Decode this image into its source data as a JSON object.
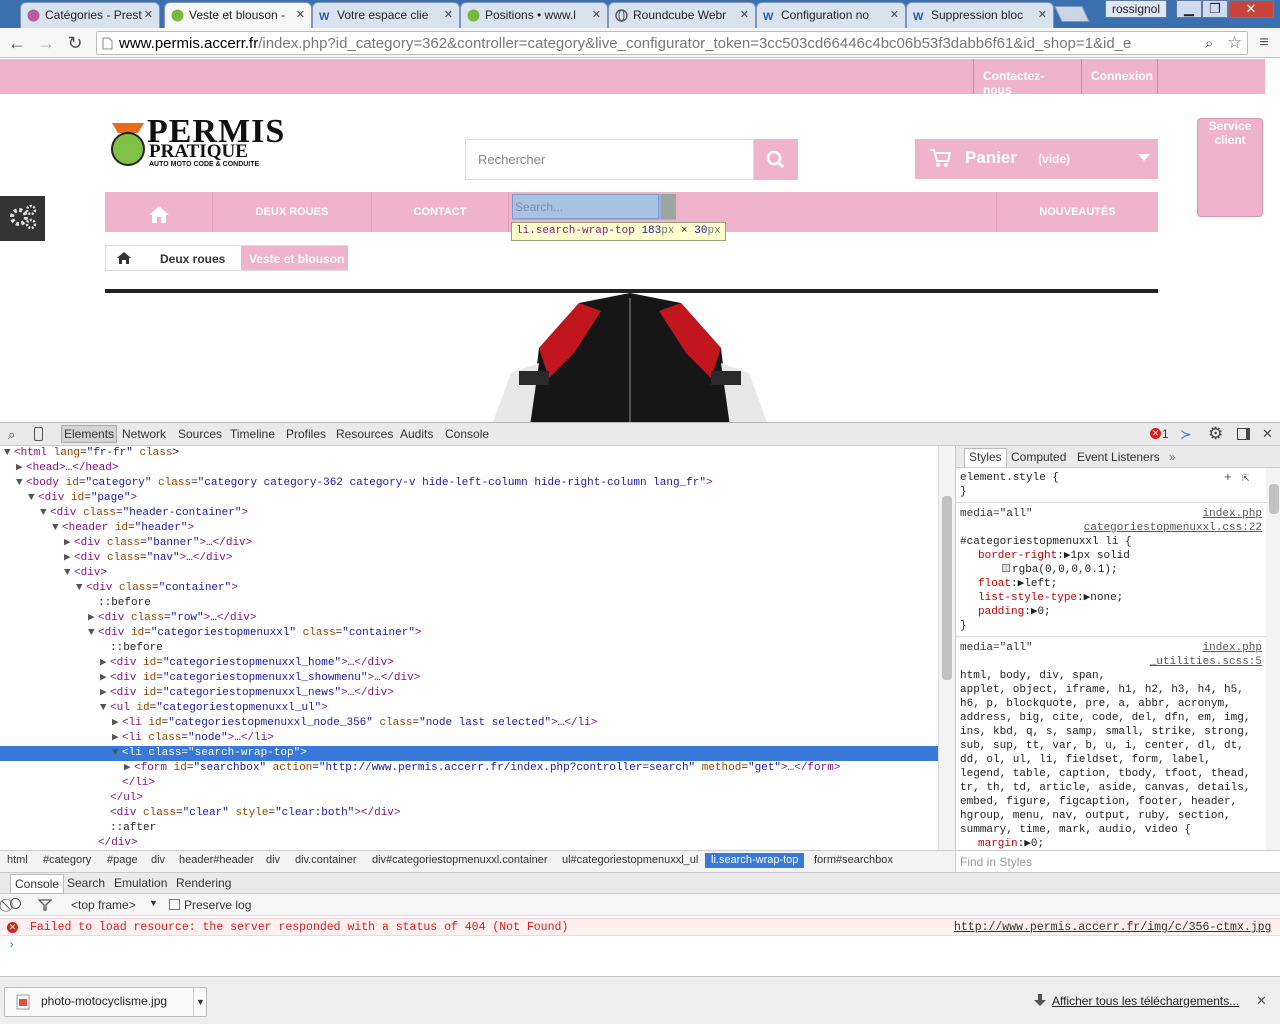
{
  "browser": {
    "tabs": [
      {
        "title": "Catégories - Prest",
        "active": false
      },
      {
        "title": "Veste et blouson -",
        "active": true
      },
      {
        "title": "Votre espace clie",
        "active": false
      },
      {
        "title": "Positions • www.l",
        "active": false
      },
      {
        "title": "Roundcube Webr",
        "active": false
      },
      {
        "title": "Configuration no",
        "active": false
      },
      {
        "title": "Suppression bloc",
        "active": false
      }
    ],
    "user": "rossignol",
    "url_domain": "www.permis.accerr.fr",
    "url_path": "/index.php?id_category=362&controller=category&live_configurator_token=3cc503cd66446c4bc06b53f3dabb6f61&id_shop=1&id_e"
  },
  "site": {
    "top_links": [
      "Contactez-nous",
      "Connexion"
    ],
    "logo": {
      "line1": "PERMIS",
      "line2": "PRATIQUE",
      "line3": "AUTO MOTO CODE & CONDUITE"
    },
    "search_placeholder": "Rechercher",
    "cart": {
      "label": "Panier",
      "status": "(vide)"
    },
    "service": {
      "line1": "Service",
      "line2": "client"
    },
    "menu": [
      "DEUX ROUES",
      "CONTACT",
      "NOUVEAUTÉS"
    ],
    "menu_search_placeholder": "Search...",
    "breadcrumb": [
      "Deux roues",
      "Veste et blouson"
    ]
  },
  "inspector_tooltip": {
    "selector": "li.search-wrap-top",
    "width": "183",
    "height": "30",
    "unit": "px"
  },
  "devtools": {
    "tabs": [
      "Elements",
      "Network",
      "Sources",
      "Timeline",
      "Profiles",
      "Resources",
      "Audits",
      "Console"
    ],
    "error_count": "1",
    "dom_lines": [
      {
        "indent": 0,
        "tri": "▼",
        "html": [
          [
            "tg",
            "<html"
          ],
          [
            "an",
            " lang"
          ],
          [
            "pl",
            "="
          ],
          [
            "av",
            "\"fr-fr\""
          ],
          [
            "an",
            " class"
          ],
          [
            "pl",
            ">"
          ]
        ]
      },
      {
        "indent": 1,
        "tri": "▶",
        "html": [
          [
            "tg",
            "<head>"
          ],
          [
            "pl",
            "…"
          ],
          [
            "tg",
            "</head>"
          ]
        ]
      },
      {
        "indent": 1,
        "tri": "▼",
        "html": [
          [
            "tg",
            "<body"
          ],
          [
            "an",
            " id"
          ],
          [
            "pl",
            "="
          ],
          [
            "av",
            "\"category\""
          ],
          [
            "an",
            " class"
          ],
          [
            "pl",
            "="
          ],
          [
            "av",
            "\"category category-362 category-v hide-left-column hide-right-column lang_fr\""
          ],
          [
            "tg",
            ">"
          ]
        ]
      },
      {
        "indent": 2,
        "tri": "▼",
        "html": [
          [
            "tg",
            "<div"
          ],
          [
            "an",
            " id"
          ],
          [
            "pl",
            "="
          ],
          [
            "av",
            "\"page\""
          ],
          [
            "tg",
            ">"
          ]
        ]
      },
      {
        "indent": 3,
        "tri": "▼",
        "html": [
          [
            "tg",
            "<div"
          ],
          [
            "an",
            " class"
          ],
          [
            "pl",
            "="
          ],
          [
            "av",
            "\"header-container\""
          ],
          [
            "tg",
            ">"
          ]
        ]
      },
      {
        "indent": 4,
        "tri": "▼",
        "html": [
          [
            "tg",
            "<header"
          ],
          [
            "an",
            " id"
          ],
          [
            "pl",
            "="
          ],
          [
            "av",
            "\"header\""
          ],
          [
            "tg",
            ">"
          ]
        ]
      },
      {
        "indent": 5,
        "tri": "▶",
        "html": [
          [
            "tg",
            "<div"
          ],
          [
            "an",
            " class"
          ],
          [
            "pl",
            "="
          ],
          [
            "av",
            "\"banner\""
          ],
          [
            "tg",
            ">"
          ],
          [
            "pl",
            "…"
          ],
          [
            "tg",
            "</div>"
          ]
        ]
      },
      {
        "indent": 5,
        "tri": "▶",
        "html": [
          [
            "tg",
            "<div"
          ],
          [
            "an",
            " class"
          ],
          [
            "pl",
            "="
          ],
          [
            "av",
            "\"nav\""
          ],
          [
            "tg",
            ">"
          ],
          [
            "pl",
            "…"
          ],
          [
            "tg",
            "</div>"
          ]
        ]
      },
      {
        "indent": 5,
        "tri": "▼",
        "html": [
          [
            "tg",
            "<div>"
          ]
        ]
      },
      {
        "indent": 6,
        "tri": "▼",
        "html": [
          [
            "tg",
            "<div"
          ],
          [
            "an",
            " class"
          ],
          [
            "pl",
            "="
          ],
          [
            "av",
            "\"container\""
          ],
          [
            "tg",
            ">"
          ]
        ]
      },
      {
        "indent": 7,
        "tri": "",
        "html": [
          [
            "pl",
            "::before"
          ]
        ]
      },
      {
        "indent": 7,
        "tri": "▶",
        "html": [
          [
            "tg",
            "<div"
          ],
          [
            "an",
            " class"
          ],
          [
            "pl",
            "="
          ],
          [
            "av",
            "\"row\""
          ],
          [
            "tg",
            ">"
          ],
          [
            "pl",
            "…"
          ],
          [
            "tg",
            "</div>"
          ]
        ]
      },
      {
        "indent": 7,
        "tri": "▼",
        "html": [
          [
            "tg",
            "<div"
          ],
          [
            "an",
            " id"
          ],
          [
            "pl",
            "="
          ],
          [
            "av",
            "\"categoriestopmenuxxl\""
          ],
          [
            "an",
            " class"
          ],
          [
            "pl",
            "="
          ],
          [
            "av",
            "\"container\""
          ],
          [
            "tg",
            ">"
          ]
        ]
      },
      {
        "indent": 8,
        "tri": "",
        "html": [
          [
            "pl",
            "::before"
          ]
        ]
      },
      {
        "indent": 8,
        "tri": "▶",
        "html": [
          [
            "tg",
            "<div"
          ],
          [
            "an",
            " id"
          ],
          [
            "pl",
            "="
          ],
          [
            "av",
            "\"categoriestopmenuxxl_home\""
          ],
          [
            "tg",
            ">"
          ],
          [
            "pl",
            "…"
          ],
          [
            "tg",
            "</div>"
          ]
        ]
      },
      {
        "indent": 8,
        "tri": "▶",
        "html": [
          [
            "tg",
            "<div"
          ],
          [
            "an",
            " id"
          ],
          [
            "pl",
            "="
          ],
          [
            "av",
            "\"categoriestopmenuxxl_showmenu\""
          ],
          [
            "tg",
            ">"
          ],
          [
            "pl",
            "…"
          ],
          [
            "tg",
            "</div>"
          ]
        ]
      },
      {
        "indent": 8,
        "tri": "▶",
        "html": [
          [
            "tg",
            "<div"
          ],
          [
            "an",
            " id"
          ],
          [
            "pl",
            "="
          ],
          [
            "av",
            "\"categoriestopmenuxxl_news\""
          ],
          [
            "tg",
            ">"
          ],
          [
            "pl",
            "…"
          ],
          [
            "tg",
            "</div>"
          ]
        ]
      },
      {
        "indent": 8,
        "tri": "▼",
        "html": [
          [
            "tg",
            "<ul"
          ],
          [
            "an",
            " id"
          ],
          [
            "pl",
            "="
          ],
          [
            "av",
            "\"categoriestopmenuxxl_ul\""
          ],
          [
            "tg",
            ">"
          ]
        ]
      },
      {
        "indent": 9,
        "tri": "▶",
        "html": [
          [
            "tg",
            "<li"
          ],
          [
            "an",
            " id"
          ],
          [
            "pl",
            "="
          ],
          [
            "av",
            "\"categoriestopmenuxxl_node_356\""
          ],
          [
            "an",
            " class"
          ],
          [
            "pl",
            "="
          ],
          [
            "av",
            "\"node last selected\""
          ],
          [
            "tg",
            ">"
          ],
          [
            "pl",
            "…"
          ],
          [
            "tg",
            "</li>"
          ]
        ]
      },
      {
        "indent": 9,
        "tri": "▶",
        "html": [
          [
            "tg",
            "<li"
          ],
          [
            "an",
            " class"
          ],
          [
            "pl",
            "="
          ],
          [
            "av",
            "\"node\""
          ],
          [
            "tg",
            ">"
          ],
          [
            "pl",
            "…"
          ],
          [
            "tg",
            "</li>"
          ]
        ]
      },
      {
        "indent": 9,
        "tri": "▼",
        "selected": true,
        "html": [
          [
            "tg",
            "<li"
          ],
          [
            "an",
            " class"
          ],
          [
            "pl",
            "="
          ],
          [
            "av",
            "\"search-wrap-top\""
          ],
          [
            "tg",
            ">"
          ]
        ]
      },
      {
        "indent": 10,
        "tri": "▶",
        "html": [
          [
            "tg",
            "<form"
          ],
          [
            "an",
            " id"
          ],
          [
            "pl",
            "="
          ],
          [
            "av",
            "\"searchbox\""
          ],
          [
            "an",
            " action"
          ],
          [
            "pl",
            "="
          ],
          [
            "av",
            "\"http://www.permis.accerr.fr/index.php?controller=search\""
          ],
          [
            "an",
            " method"
          ],
          [
            "pl",
            "="
          ],
          [
            "av",
            "\"get\""
          ],
          [
            "tg",
            ">"
          ],
          [
            "pl",
            "…"
          ],
          [
            "tg",
            "</form>"
          ]
        ]
      },
      {
        "indent": 9,
        "tri": "",
        "html": [
          [
            "tg",
            "</li>"
          ]
        ]
      },
      {
        "indent": 8,
        "tri": "",
        "html": [
          [
            "tg",
            "</ul>"
          ]
        ]
      },
      {
        "indent": 8,
        "tri": "",
        "html": [
          [
            "tg",
            "<div"
          ],
          [
            "an",
            " class"
          ],
          [
            "pl",
            "="
          ],
          [
            "av",
            "\"clear\""
          ],
          [
            "an",
            " style"
          ],
          [
            "pl",
            "="
          ],
          [
            "av",
            "\"clear:both\""
          ],
          [
            "tg",
            ">"
          ],
          [
            "tg",
            "</div>"
          ]
        ]
      },
      {
        "indent": 8,
        "tri": "",
        "html": [
          [
            "pl",
            "::after"
          ]
        ]
      },
      {
        "indent": 7,
        "tri": "",
        "html": [
          [
            "tg",
            "</div>"
          ]
        ]
      }
    ],
    "styles_tabs": [
      "Styles",
      "Computed",
      "Event Listeners"
    ],
    "styles": {
      "element_style": "element.style {",
      "element_style_close": "}",
      "rule1_media": "media=\"all\"",
      "rule1_file": "index.php",
      "rule1_src": "categoriestopmenuxxl.css:22",
      "rule1_selector": "#categoriestopmenuxxl li {",
      "rule1_props": [
        {
          "name": "border-right",
          "value": "1px solid"
        },
        {
          "name": "",
          "value": "rgba(0,0,0,0.1);"
        },
        {
          "name": "float",
          "value": "left;"
        },
        {
          "name": "list-style-type",
          "value": "none;"
        },
        {
          "name": "padding",
          "value": "0;"
        }
      ],
      "rule2_media": "media=\"all\"",
      "rule2_file": "index.php",
      "rule2_src": "_utilities.scss:5",
      "rule2_selector_lines": [
        "html, body, div, span,",
        "applet, object, iframe, h1, h2, h3, h4, h5,",
        "h6, p, blockquote, pre, a, abbr, acronym,",
        "address, big, cite, code, del, dfn, em, img,",
        "ins, kbd, q, s, samp, small, strike, strong,",
        "sub, sup, tt, var, b, u, i, center, dl, dt,",
        "dd, ol, ul, li, fieldset, form, label,",
        "legend, table, caption, tbody, tfoot, thead,",
        "tr, th, td, article, aside, canvas, details,",
        "embed, figure, figcaption, footer, header,",
        "hgroup, menu, nav, output, ruby, section,",
        "summary, time, mark, audio, video {"
      ],
      "rule2_props": [
        {
          "name": "margin",
          "value": "0;"
        },
        {
          "name": "padding",
          "value": "0;"
        }
      ],
      "find_placeholder": "Find in Styles"
    },
    "crumbs": [
      "html",
      "#category",
      "#page",
      "div",
      "header#header",
      "div",
      "div.container",
      "div#categoriestopmenuxxl.container",
      "ul#categoriestopmenuxxl_ul",
      "li.search-wrap-top",
      "form#searchbox"
    ],
    "drawer_tabs": [
      "Console",
      "Search",
      "Emulation",
      "Rendering"
    ],
    "console_frame": "<top frame>",
    "preserve_log": "Preserve log",
    "error_message": "Failed to load resource: the server responded with a status of 404 (Not Found)",
    "error_link": "http://www.permis.accerr.fr/img/c/356-ctmx.jpg",
    "prompt": "›"
  },
  "downloads": {
    "file": "photo-motocyclisme.jpg",
    "show_all": "Afficher tous les téléchargements..."
  },
  "colors": {
    "pink": "#f0b3cc",
    "tab_strip": "#3a6fb0",
    "selection": "#3879d9",
    "error": "#d81e1e"
  }
}
